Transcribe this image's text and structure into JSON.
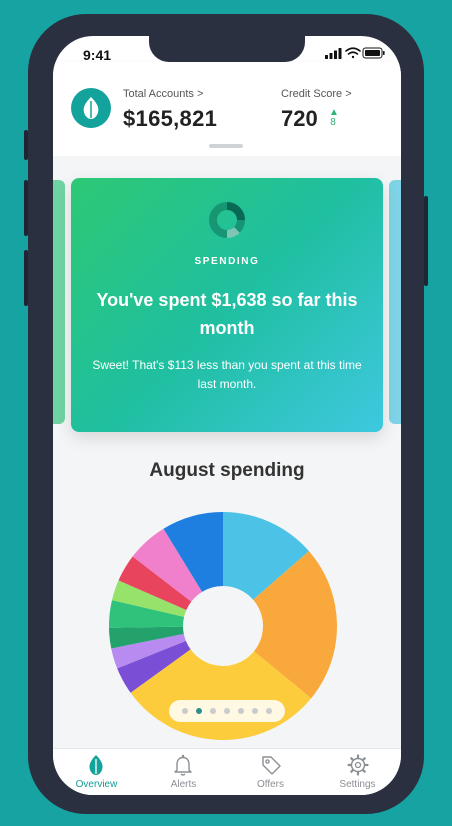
{
  "status_bar": {
    "time": "9:41"
  },
  "header": {
    "total_accounts_label": "Total Accounts >",
    "total_accounts_value": "$165,821",
    "credit_score_label": "Credit Score >",
    "credit_score_value": "720",
    "credit_score_change": "8"
  },
  "card": {
    "eyebrow": "SPENDING",
    "title": "You've spent $1,638 so far this month",
    "subtitle": "Sweet! That's $113 less than you spent at this time last month."
  },
  "chart_data": {
    "type": "pie",
    "title": "August spending",
    "slices": [
      {
        "value": 14,
        "color": "#4cc3e6"
      },
      {
        "value": 23,
        "color": "#f9a83b"
      },
      {
        "value": 30,
        "color": "#fccc3c"
      },
      {
        "value": 4,
        "color": "#7a4fd6"
      },
      {
        "value": 3,
        "color": "#b78bf0"
      },
      {
        "value": 3,
        "color": "#23a26b"
      },
      {
        "value": 4,
        "color": "#2ec27b"
      },
      {
        "value": 3,
        "color": "#96e26a"
      },
      {
        "value": 4,
        "color": "#e8445e"
      },
      {
        "value": 6,
        "color": "#f080cc"
      },
      {
        "value": 9,
        "color": "#1f7fe0"
      }
    ]
  },
  "pager": {
    "count": 7,
    "active_index": 1
  },
  "tabs": [
    {
      "label": "Overview",
      "icon": "leaf-icon",
      "active": true
    },
    {
      "label": "Alerts",
      "icon": "bell-icon",
      "active": false
    },
    {
      "label": "Offers",
      "icon": "tag-icon",
      "active": false
    },
    {
      "label": "Settings",
      "icon": "gear-icon",
      "active": false
    }
  ],
  "colors": {
    "brand": "#14a39c",
    "background": "#17a3a1",
    "positive": "#2ab573"
  }
}
